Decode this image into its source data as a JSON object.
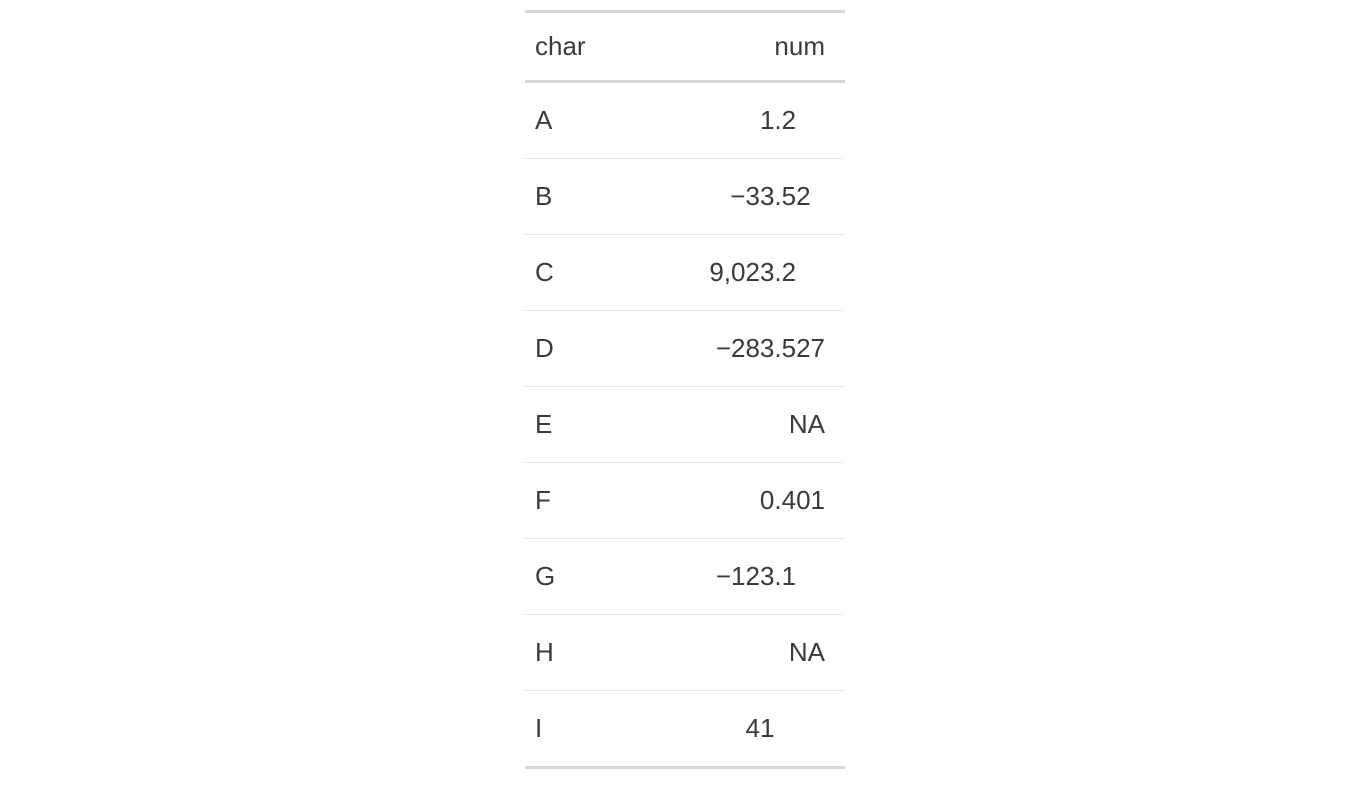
{
  "chart_data": {
    "type": "table",
    "columns": [
      "char",
      "num"
    ],
    "rows": [
      {
        "char": "A",
        "num": 1.2
      },
      {
        "char": "B",
        "num": -33.52
      },
      {
        "char": "C",
        "num": 9023.2
      },
      {
        "char": "D",
        "num": -283.527
      },
      {
        "char": "E",
        "num": null
      },
      {
        "char": "F",
        "num": 0.401
      },
      {
        "char": "G",
        "num": -123.1
      },
      {
        "char": "H",
        "num": null
      },
      {
        "char": "I",
        "num": 41
      }
    ]
  },
  "headers": {
    "char": "char",
    "num": "num"
  },
  "display": {
    "rows": [
      {
        "char": "A",
        "num": "1.2    "
      },
      {
        "char": "B",
        "num": "−33.52  "
      },
      {
        "char": "C",
        "num": "9,023.2    "
      },
      {
        "char": "D",
        "num": "−283.527"
      },
      {
        "char": "E",
        "num": "NA"
      },
      {
        "char": "F",
        "num": "0.401"
      },
      {
        "char": "G",
        "num": "−123.1    "
      },
      {
        "char": "H",
        "num": "NA"
      },
      {
        "char": "I",
        "num": "41       "
      }
    ]
  }
}
